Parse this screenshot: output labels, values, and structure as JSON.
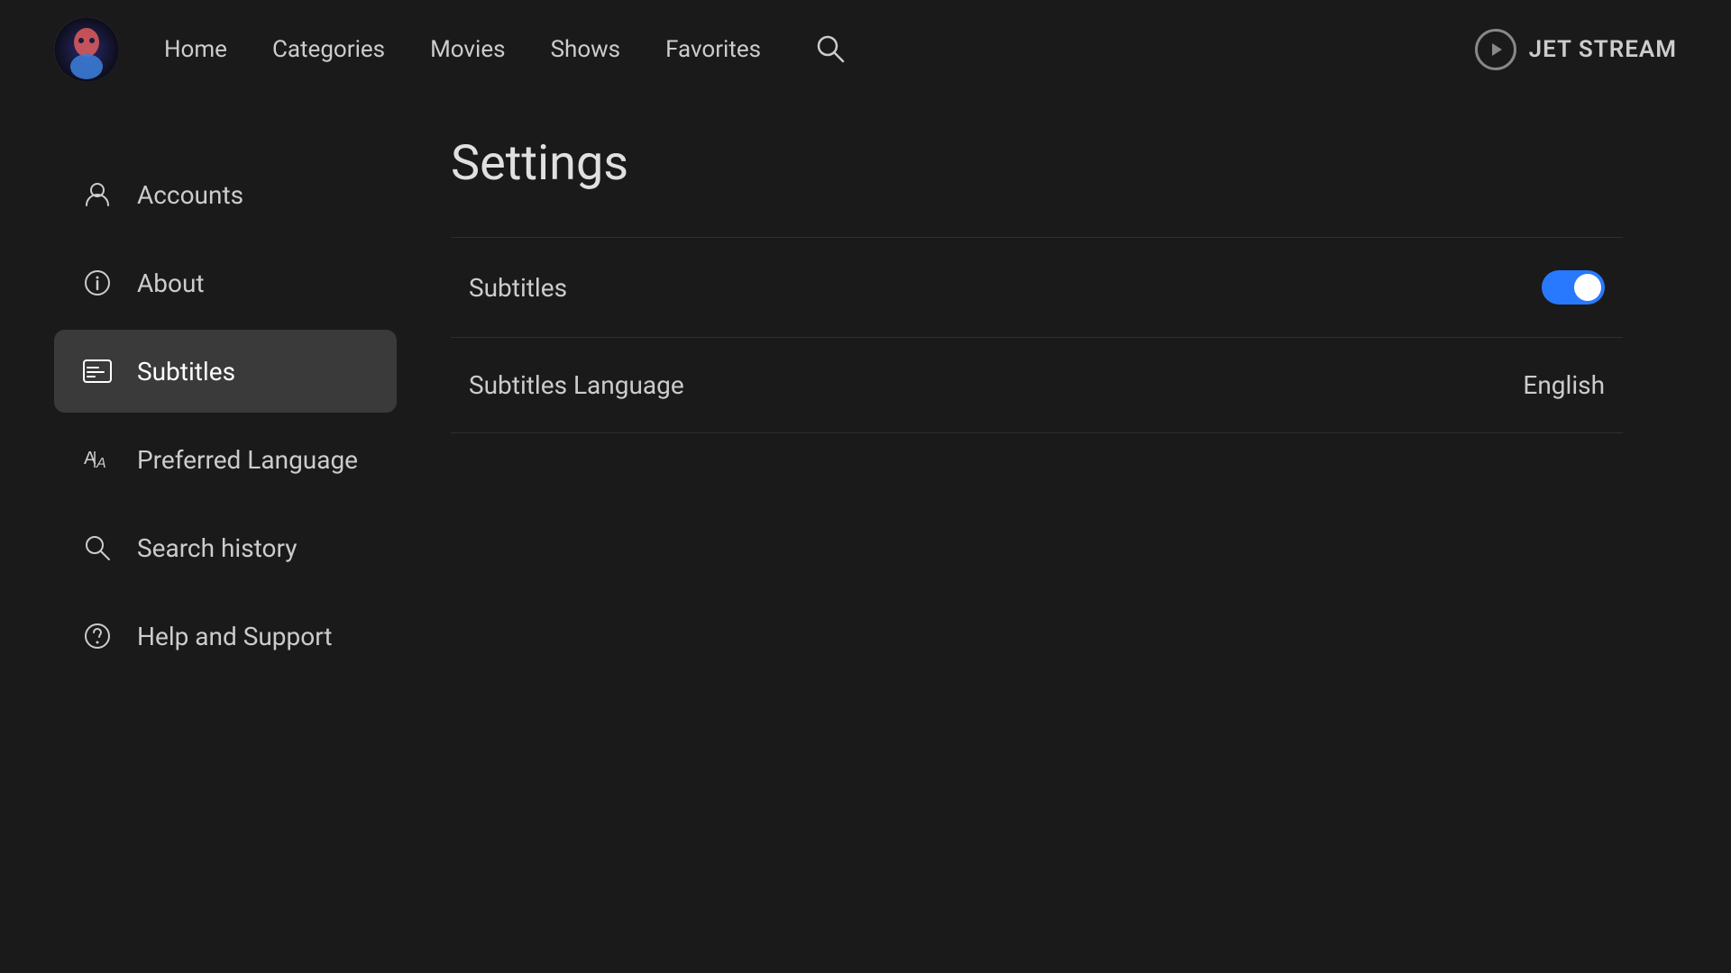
{
  "header": {
    "nav": {
      "home": "Home",
      "categories": "Categories",
      "movies": "Movies",
      "shows": "Shows",
      "favorites": "Favorites"
    },
    "brand": "JET STREAM"
  },
  "sidebar": {
    "items": [
      {
        "id": "accounts",
        "label": "Accounts",
        "icon": "user-icon"
      },
      {
        "id": "about",
        "label": "About",
        "icon": "info-icon"
      },
      {
        "id": "subtitles",
        "label": "Subtitles",
        "icon": "subtitles-icon",
        "active": true
      },
      {
        "id": "preferred-language",
        "label": "Preferred Language",
        "icon": "language-icon"
      },
      {
        "id": "search-history",
        "label": "Search history",
        "icon": "search-icon"
      },
      {
        "id": "help-and-support",
        "label": "Help and Support",
        "icon": "help-icon"
      }
    ]
  },
  "content": {
    "title": "Settings",
    "rows": [
      {
        "id": "subtitles-toggle",
        "label": "Subtitles",
        "type": "toggle",
        "value": true
      },
      {
        "id": "subtitles-language",
        "label": "Subtitles Language",
        "type": "value",
        "value": "English"
      }
    ]
  },
  "colors": {
    "toggle_on": "#2979ff",
    "accent": "#2979ff",
    "bg": "#1a1a1a",
    "sidebar_active": "#3a3a3a",
    "text_primary": "#e0e0e0",
    "text_secondary": "#cccccc"
  }
}
